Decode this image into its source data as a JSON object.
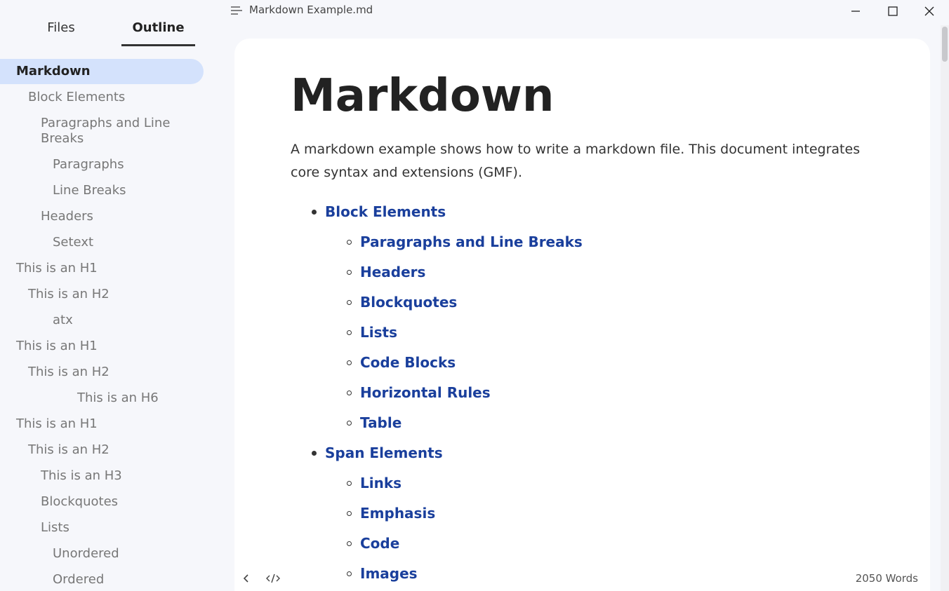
{
  "titlebar": {
    "document_title": "Markdown Example.md"
  },
  "sidebar": {
    "tabs": [
      {
        "label": "Files"
      },
      {
        "label": "Outline"
      }
    ],
    "outline": [
      {
        "label": "Markdown",
        "level": 1,
        "active": true
      },
      {
        "label": "Block Elements",
        "level": 2
      },
      {
        "label": "Paragraphs and Line Breaks",
        "level": 3
      },
      {
        "label": "Paragraphs",
        "level": 4
      },
      {
        "label": "Line Breaks",
        "level": 4
      },
      {
        "label": "Headers",
        "level": 3
      },
      {
        "label": "Setext",
        "level": 4
      },
      {
        "label": "This is an H1",
        "level": 1
      },
      {
        "label": "This is an H2",
        "level": 2
      },
      {
        "label": "atx",
        "level": 4
      },
      {
        "label": "This is an H1",
        "level": 1
      },
      {
        "label": "This is an H2",
        "level": 2
      },
      {
        "label": "This is an H6",
        "level": 6
      },
      {
        "label": "This is an H1",
        "level": 1
      },
      {
        "label": "This is an H2",
        "level": 2
      },
      {
        "label": "This is an H3",
        "level": 3
      },
      {
        "label": "Blockquotes",
        "level": 3
      },
      {
        "label": "Lists",
        "level": 3
      },
      {
        "label": "Unordered",
        "level": 4
      },
      {
        "label": "Ordered",
        "level": 4
      }
    ]
  },
  "document": {
    "heading": "Markdown",
    "intro": "A markdown example shows how to write a markdown file. This document integrates core syntax and extensions (GMF).",
    "toc": [
      {
        "label": "Block Elements",
        "level": 1
      },
      {
        "label": "Paragraphs and Line Breaks",
        "level": 2
      },
      {
        "label": "Headers",
        "level": 2
      },
      {
        "label": "Blockquotes",
        "level": 2
      },
      {
        "label": "Lists",
        "level": 2
      },
      {
        "label": "Code Blocks",
        "level": 2
      },
      {
        "label": "Horizontal Rules",
        "level": 2
      },
      {
        "label": "Table",
        "level": 2
      },
      {
        "label": "Span Elements",
        "level": 1
      },
      {
        "label": "Links",
        "level": 2
      },
      {
        "label": "Emphasis",
        "level": 2
      },
      {
        "label": "Code",
        "level": 2
      },
      {
        "label": "Images",
        "level": 2
      }
    ]
  },
  "statusbar": {
    "word_count": "2050 Words"
  },
  "icons": {
    "menu": "menu-icon",
    "minimize": "minimize-icon",
    "maximize": "maximize-icon",
    "close": "close-icon",
    "toggle_sidebar": "chevron-left-icon",
    "source_mode": "code-icon"
  },
  "colors": {
    "link": "#1a3f9c",
    "active_outline_bg": "#d4e2fc",
    "sidebar_bg": "#f6f7fb",
    "editor_bg": "#ffffff"
  }
}
